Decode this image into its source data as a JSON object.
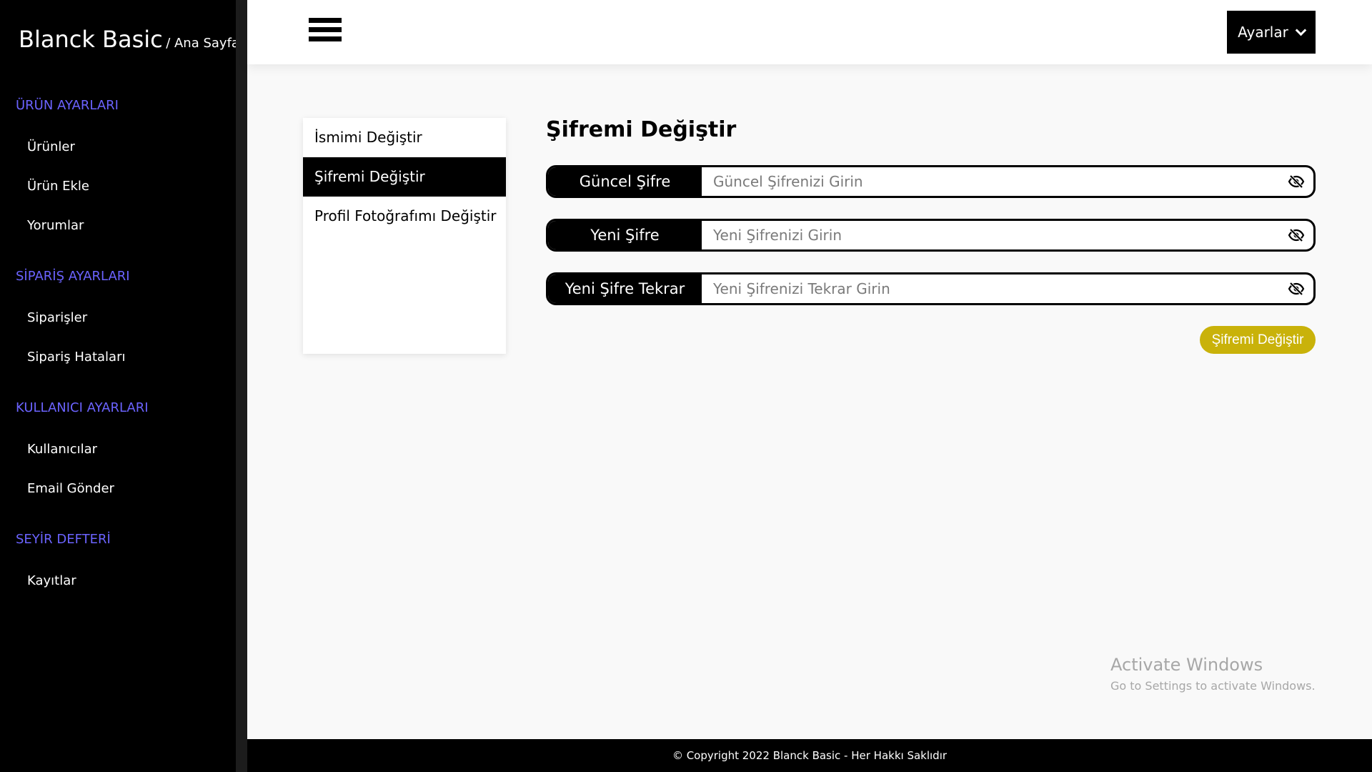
{
  "brand": {
    "name": "Blanck Basic",
    "crumb": "/ Ana Sayfa"
  },
  "sidebar": {
    "sections": [
      {
        "heading": "ÜRÜN AYARLARI",
        "items": [
          "Ürünler",
          "Ürün Ekle",
          "Yorumlar"
        ]
      },
      {
        "heading": "SİPARİŞ AYARLARI",
        "items": [
          "Siparişler",
          "Sipariş Hataları"
        ]
      },
      {
        "heading": "KULLANICI AYARLARI",
        "items": [
          "Kullanıcılar",
          "Email Gönder"
        ]
      },
      {
        "heading": "SEYİR DEFTERİ",
        "items": [
          "Kayıtlar"
        ]
      }
    ]
  },
  "topbar": {
    "settings_label": "Ayarlar"
  },
  "side_menu": {
    "items": [
      "İsmimi Değiştir",
      "Şifremi Değiştir",
      "Profil Fotoğrafımı Değiştir"
    ],
    "active_index": 1
  },
  "form": {
    "title": "Şifremi Değiştir",
    "fields": [
      {
        "label": "Güncel Şifre",
        "placeholder": "Güncel Şifrenizi Girin",
        "value": ""
      },
      {
        "label": "Yeni Şifre",
        "placeholder": "Yeni Şifrenizi Girin",
        "value": ""
      },
      {
        "label": "Yeni Şifre Tekrar",
        "placeholder": "Yeni Şifrenizi Tekrar Girin",
        "value": ""
      }
    ],
    "submit_label": "Şifremi Değiştir"
  },
  "watermark": {
    "title": "Activate Windows",
    "subtitle": "Go to Settings to activate Windows."
  },
  "footer": {
    "text": "© Copyright 2022 Blanck Basic - Her Hakkı Saklıdır"
  },
  "colors": {
    "accent_heading": "#6b63ff",
    "submit_button": "#c9b20a",
    "sidebar_bg": "#000000"
  },
  "icons": {
    "menu": "hamburger-menu-icon",
    "dropdown": "chevron-down-icon",
    "password_toggle": "eye-slash-icon"
  }
}
